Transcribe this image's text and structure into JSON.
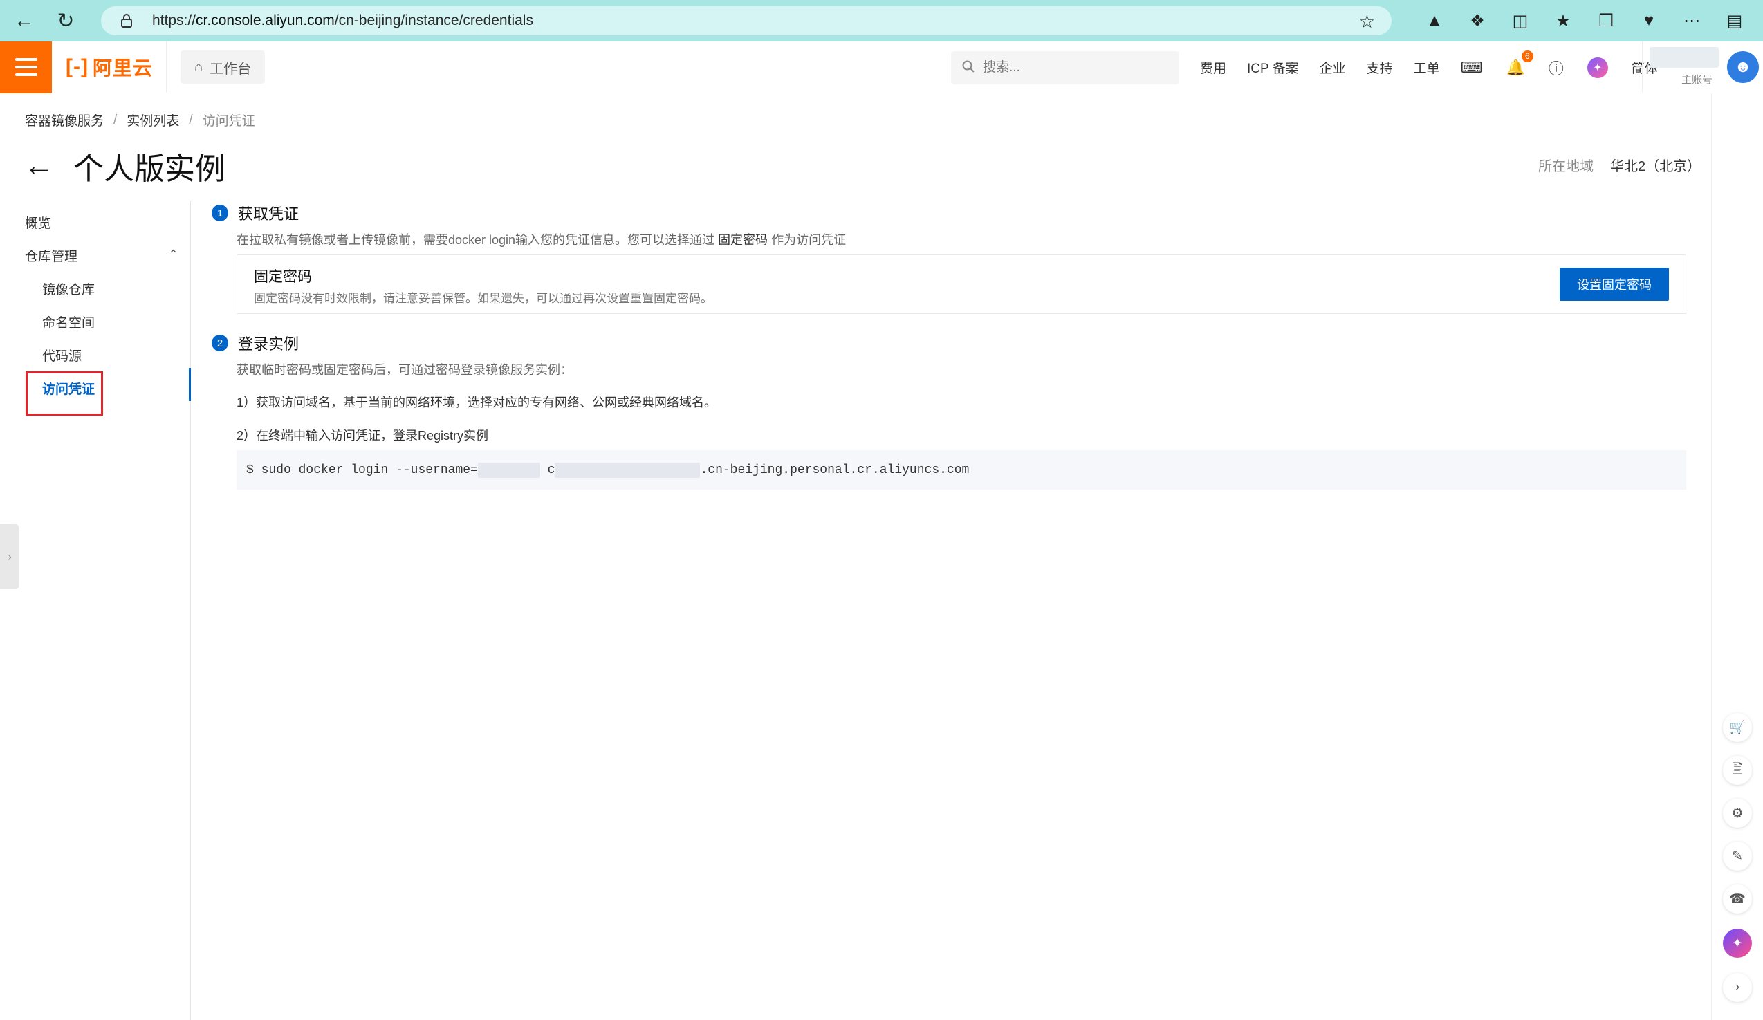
{
  "browser": {
    "url_prefix": "https://",
    "url_host": "cr.console.aliyun.com",
    "url_path": "/cn-beijing/instance/credentials"
  },
  "header": {
    "logo": "阿里云",
    "workbench": "工作台",
    "search_placeholder": "搜索...",
    "links": [
      "费用",
      "ICP 备案",
      "企业",
      "支持",
      "工单"
    ],
    "notification_count": "6",
    "language": "简体",
    "account_role": "主账号"
  },
  "breadcrumb": [
    "容器镜像服务",
    "实例列表",
    "访问凭证"
  ],
  "page": {
    "title": "个人版实例",
    "region_label": "所在地域",
    "region_value": "华北2（北京）"
  },
  "sidenav": {
    "overview": "概览",
    "repo_mgmt": "仓库管理",
    "image_repo": "镜像仓库",
    "namespace": "命名空间",
    "code_source": "代码源",
    "credentials": "访问凭证"
  },
  "step1": {
    "num": "1",
    "title": "获取凭证",
    "desc_pre": "在拉取私有镜像或者上传镜像前，需要docker login输入您的凭证信息。您可以选择通过 ",
    "desc_link": "固定密码",
    "desc_post": " 作为访问凭证",
    "card_title": "固定密码",
    "card_desc": "固定密码没有时效限制，请注意妥善保管。如果遗失，可以通过再次设置重置固定密码。",
    "button": "设置固定密码"
  },
  "step2": {
    "num": "2",
    "title": "登录实例",
    "desc": "获取临时密码或固定密码后，可通过密码登录镜像服务实例：",
    "line1": "1）获取访问域名，基于当前的网络环境，选择对应的专有网络、公网或经典网络域名。",
    "line2": "2）在终端中输入访问凭证，登录Registry实例",
    "cmd_prefix": "$ sudo docker login --username=",
    "cmd_mid": " c",
    "cmd_suffix": ".cn-beijing.personal.cr.aliyuncs.com"
  }
}
